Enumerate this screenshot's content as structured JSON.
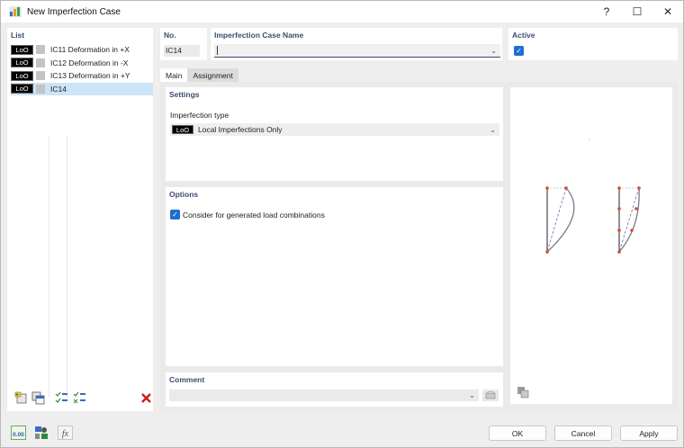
{
  "window": {
    "title": "New Imperfection Case",
    "help_icon": "?",
    "maximize_icon": "☐",
    "close_icon": "✕"
  },
  "list": {
    "header": "List",
    "items": [
      {
        "badge": "LoO",
        "label": "IC11  Deformation in +X"
      },
      {
        "badge": "LoO",
        "label": "IC12  Deformation in -X"
      },
      {
        "badge": "LoO",
        "label": "IC13  Deformation in +Y"
      },
      {
        "badge": "LoO",
        "label": "IC14"
      }
    ],
    "selected_index": 3
  },
  "no": {
    "header": "No.",
    "value": "IC14"
  },
  "name": {
    "header": "Imperfection Case Name",
    "value": ""
  },
  "active": {
    "header": "Active",
    "checked": true
  },
  "tabs": [
    {
      "label": "Main",
      "active": true
    },
    {
      "label": "Assignment",
      "active": false
    }
  ],
  "settings": {
    "header": "Settings",
    "imperfection_type_label": "Imperfection type",
    "imperfection_type_badge": "LoO",
    "imperfection_type_value": "Local Imperfections Only"
  },
  "options": {
    "header": "Options",
    "consider_generated_label": "Consider for generated load combinations",
    "consider_generated_checked": true
  },
  "comment": {
    "header": "Comment",
    "value": ""
  },
  "buttons": {
    "ok": "OK",
    "cancel": "Cancel",
    "apply": "Apply"
  },
  "bottom_tools": {
    "units_label": "0.00"
  },
  "colors": {
    "accent": "#1f6ed4",
    "section_head": "#3a4e6e",
    "selected_row": "#cce4f7",
    "node_red": "#e0452e",
    "curve": "#7a7a8c",
    "delete_red": "#d11a1a"
  }
}
